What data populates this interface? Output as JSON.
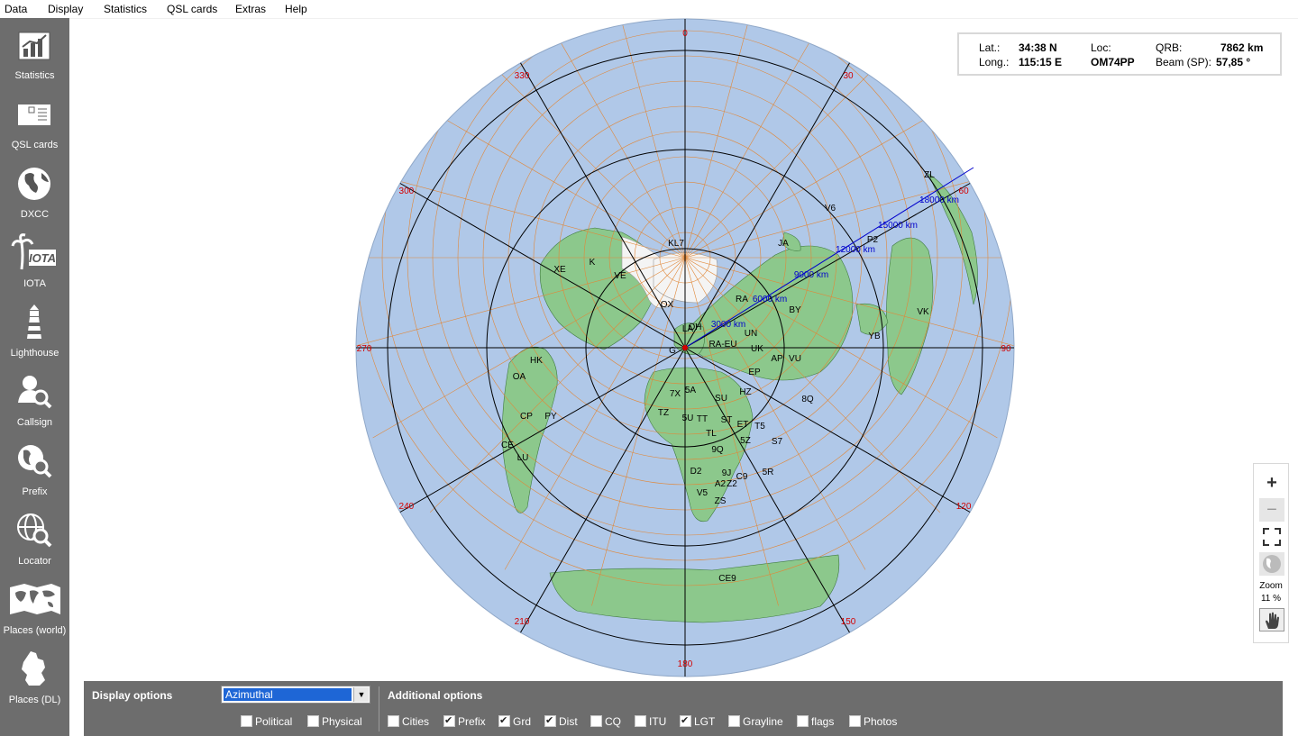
{
  "menu": [
    "Data",
    "Display",
    "Statistics",
    "QSL cards",
    "Extras",
    "Help"
  ],
  "sidebar": [
    {
      "label": "Statistics",
      "icon": "statistics-icon"
    },
    {
      "label": "QSL cards",
      "icon": "qsl-card-icon"
    },
    {
      "label": "DXCC",
      "icon": "globe-icon"
    },
    {
      "label": "IOTA",
      "icon": "iota-palm-icon"
    },
    {
      "label": "Lighthouse",
      "icon": "lighthouse-icon"
    },
    {
      "label": "Callsign",
      "icon": "callsign-search-icon"
    },
    {
      "label": "Prefix",
      "icon": "prefix-search-icon"
    },
    {
      "label": "Locator",
      "icon": "locator-search-icon"
    },
    {
      "label": "Places (world)",
      "icon": "world-map-icon"
    },
    {
      "label": "Places (DL)",
      "icon": "germany-map-icon"
    }
  ],
  "info": {
    "lat_label": "Lat.:",
    "lat": "34:38 N",
    "long_label": "Long.:",
    "long": "115:15 E",
    "loc_label": "Loc:",
    "loc": "OM74PP",
    "qrb_label": "QRB:",
    "qrb": "7862 km",
    "beam_label": "Beam (SP):",
    "beam": "57,85 °"
  },
  "map": {
    "azimuth_labels": [
      "0",
      "30",
      "60",
      "90",
      "120",
      "150",
      "180",
      "210",
      "240",
      "270",
      "300",
      "330"
    ],
    "distance_labels": [
      "3000 km",
      "6000 km",
      "9000 km",
      "12000 km",
      "15000 km",
      "18000 km"
    ],
    "prefixes": [
      "KL7",
      "JA",
      "ZL",
      "V6",
      "P2",
      "VK",
      "YB",
      "K",
      "VE",
      "XE",
      "OX",
      "RA",
      "BY",
      "UN",
      "RA-EU",
      "UK",
      "AP",
      "VU",
      "EP",
      "HZ",
      "8Q",
      "SU",
      "5A",
      "7X",
      "ST",
      "TT",
      "5U",
      "TZ",
      "T5",
      "ET",
      "TL",
      "5Z",
      "5R",
      "S7",
      "9Q",
      "9J",
      "C9",
      "D2",
      "A2",
      "Z2",
      "V5",
      "ZS",
      "HK",
      "OA",
      "CP",
      "PY",
      "CE",
      "LU",
      "CE9",
      "OH",
      "LA",
      "G"
    ],
    "colors": {
      "ocean": "#b0c8e8",
      "land": "#8cc88c",
      "grid": "#e0883a",
      "azimuth": "#d40000",
      "distance": "#0000cc"
    }
  },
  "zoom": {
    "label": "Zoom",
    "value": "11 %"
  },
  "bottom": {
    "display_options_label": "Display options",
    "projection": "Azimuthal",
    "additional_options_label": "Additional options",
    "display_checks": [
      {
        "label": "Political",
        "checked": false
      },
      {
        "label": "Physical",
        "checked": false
      }
    ],
    "additional_checks": [
      {
        "label": "Cities",
        "checked": false
      },
      {
        "label": "Prefix",
        "checked": true
      },
      {
        "label": "Grd",
        "checked": true
      },
      {
        "label": "Dist",
        "checked": true
      },
      {
        "label": "CQ",
        "checked": false
      },
      {
        "label": "ITU",
        "checked": false
      },
      {
        "label": "LGT",
        "checked": true
      },
      {
        "label": "Grayline",
        "checked": false
      },
      {
        "label": "flags",
        "checked": false
      },
      {
        "label": "Photos",
        "checked": false
      }
    ]
  }
}
